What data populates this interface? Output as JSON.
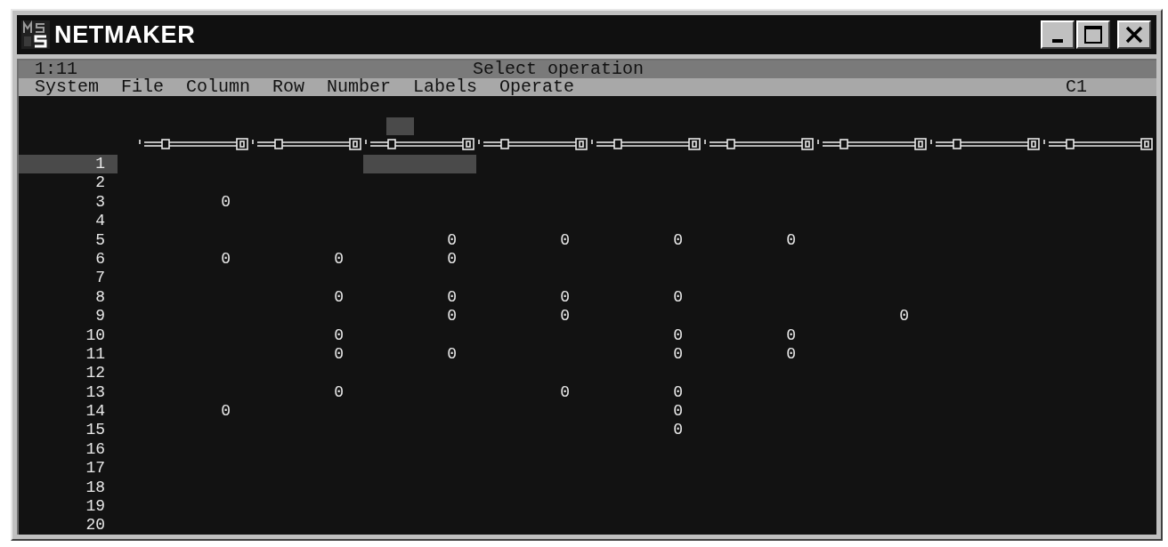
{
  "window": {
    "title": "NETMAKER"
  },
  "status_bar": {
    "position": "1:11",
    "message": "Select operation"
  },
  "menu": {
    "items": [
      "System",
      "File",
      "Column",
      "Row",
      "Number",
      "Labels",
      "Operate"
    ],
    "cell_ref": "C1"
  },
  "columns": [
    {
      "selected": false
    },
    {
      "selected": false
    },
    {
      "selected": true
    },
    {
      "selected": false
    },
    {
      "selected": false
    },
    {
      "selected": false
    },
    {
      "selected": false
    },
    {
      "selected": false
    },
    {
      "selected": false
    }
  ],
  "rows": [
    {
      "label": "1",
      "selected": true,
      "cells": [
        null,
        null,
        null,
        null,
        null,
        null,
        null,
        null,
        null
      ]
    },
    {
      "label": "2",
      "selected": false,
      "cells": [
        null,
        null,
        null,
        null,
        null,
        null,
        null,
        null,
        null
      ]
    },
    {
      "label": "3",
      "selected": false,
      "cells": [
        "0",
        null,
        null,
        null,
        null,
        null,
        null,
        null,
        null
      ]
    },
    {
      "label": "4",
      "selected": false,
      "cells": [
        null,
        null,
        null,
        null,
        null,
        null,
        null,
        null,
        null
      ]
    },
    {
      "label": "5",
      "selected": false,
      "cells": [
        null,
        null,
        "0",
        "0",
        "0",
        "0",
        null,
        null,
        null
      ]
    },
    {
      "label": "6",
      "selected": false,
      "cells": [
        "0",
        "0",
        "0",
        null,
        null,
        null,
        null,
        null,
        null
      ]
    },
    {
      "label": "7",
      "selected": false,
      "cells": [
        null,
        null,
        null,
        null,
        null,
        null,
        null,
        null,
        null
      ]
    },
    {
      "label": "8",
      "selected": false,
      "cells": [
        null,
        "0",
        "0",
        "0",
        "0",
        null,
        null,
        null,
        null
      ]
    },
    {
      "label": "9",
      "selected": false,
      "cells": [
        null,
        null,
        "0",
        "0",
        null,
        null,
        "0",
        null,
        null
      ]
    },
    {
      "label": "10",
      "selected": false,
      "cells": [
        null,
        "0",
        null,
        null,
        "0",
        "0",
        null,
        null,
        null
      ]
    },
    {
      "label": "11",
      "selected": false,
      "cells": [
        null,
        "0",
        "0",
        null,
        "0",
        "0",
        null,
        null,
        null
      ]
    },
    {
      "label": "12",
      "selected": false,
      "cells": [
        null,
        null,
        null,
        null,
        null,
        null,
        null,
        null,
        null
      ]
    },
    {
      "label": "13",
      "selected": false,
      "cells": [
        null,
        "0",
        null,
        "0",
        "0",
        null,
        null,
        null,
        null
      ]
    },
    {
      "label": "14",
      "selected": false,
      "cells": [
        "0",
        null,
        null,
        null,
        "0",
        null,
        null,
        null,
        null
      ]
    },
    {
      "label": "15",
      "selected": false,
      "cells": [
        null,
        null,
        null,
        null,
        "0",
        null,
        null,
        null,
        null
      ]
    },
    {
      "label": "16",
      "selected": false,
      "cells": [
        null,
        null,
        null,
        null,
        null,
        null,
        null,
        null,
        null
      ]
    },
    {
      "label": "17",
      "selected": false,
      "cells": [
        null,
        null,
        null,
        null,
        null,
        null,
        null,
        null,
        null
      ]
    },
    {
      "label": "18",
      "selected": false,
      "cells": [
        null,
        null,
        null,
        null,
        null,
        null,
        null,
        null,
        null
      ]
    },
    {
      "label": "19",
      "selected": false,
      "cells": [
        null,
        null,
        null,
        null,
        null,
        null,
        null,
        null,
        null
      ]
    },
    {
      "label": "20",
      "selected": false,
      "cells": [
        null,
        null,
        null,
        null,
        null,
        null,
        null,
        null,
        null
      ]
    }
  ]
}
